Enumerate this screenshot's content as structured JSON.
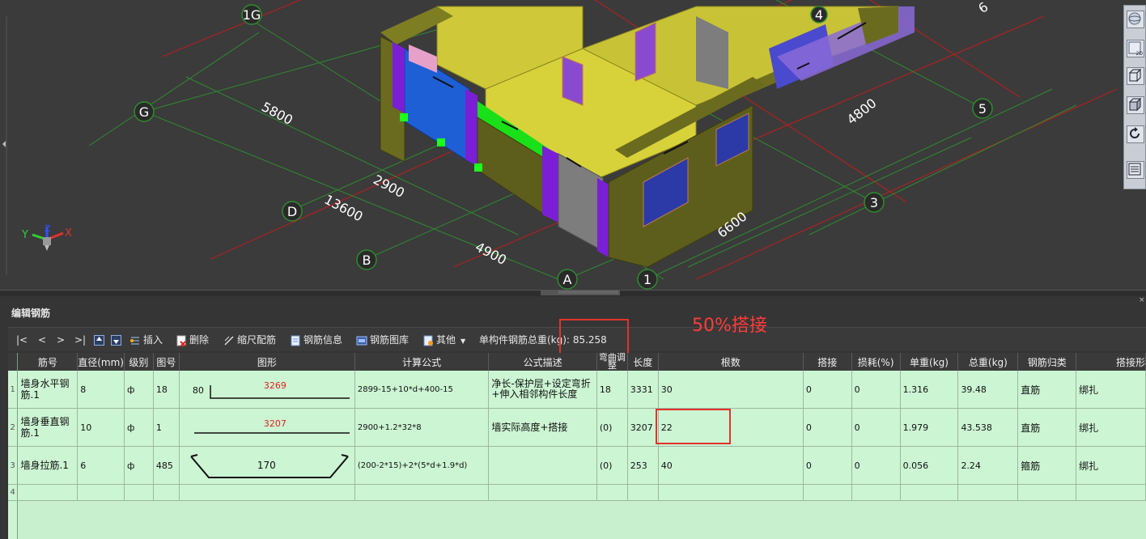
{
  "viewport": {
    "axis_labels": [
      "1G",
      "G",
      "D",
      "B",
      "A",
      "1",
      "3",
      "5",
      "4",
      "6"
    ],
    "dimensions": [
      "5800",
      "2900",
      "13600",
      "4900",
      "4800",
      "6600"
    ],
    "gizmo": {
      "x": "X",
      "y": "Y",
      "z": "Z"
    }
  },
  "viewbar": {
    "buttons": [
      "globe-icon",
      "view-2d-icon",
      "cube-3d-icon",
      "cube-solid-icon",
      "rotate-icon",
      "layer-list-icon"
    ],
    "label_2d": "2D"
  },
  "panel": {
    "title": "编辑钢筋",
    "nav": [
      "|<",
      "<",
      ">",
      ">|"
    ],
    "buttons": {
      "insert": "插入",
      "delete": "删除",
      "scale": "缩尺配筋",
      "info": "钢筋信息",
      "library": "钢筋图库",
      "other": "其他"
    },
    "weight_label": "单构件钢筋总重(kg):",
    "weight_value": "85.258"
  },
  "annotation": "50%搭接",
  "table": {
    "headers": [
      "筋号",
      "直径(mm)",
      "级别",
      "图号",
      "图形",
      "计算公式",
      "公式描述",
      "弯曲调整",
      "长度",
      "根数",
      "搭接",
      "损耗(%)",
      "单重(kg)",
      "总重(kg)",
      "钢筋归类",
      "搭接形"
    ],
    "rows": [
      {
        "num": "1",
        "name": "墙身水平钢筋.1",
        "dia": "8",
        "grade": "ф",
        "fig": "18",
        "shape_left": "80",
        "shape_value": "3269",
        "formula": "2899-15+10*d+400-15",
        "desc": "净长-保护层+设定弯折+伸入相邻构件长度",
        "bend": "18",
        "length": "3331",
        "count": "30",
        "lap": "0",
        "loss": "0",
        "unit": "1.316",
        "total": "39.48",
        "cat": "直筋",
        "laptype": "绑扎"
      },
      {
        "num": "2",
        "name": "墙身垂直钢筋.1",
        "dia": "10",
        "grade": "ф",
        "fig": "1",
        "shape_left": "",
        "shape_value": "3207",
        "formula": "2900+1.2*32*8",
        "desc": "墙实际高度+搭接",
        "bend": "(0)",
        "length": "3207",
        "count": "22",
        "lap": "0",
        "loss": "0",
        "unit": "1.979",
        "total": "43.538",
        "cat": "直筋",
        "laptype": "绑扎"
      },
      {
        "num": "3",
        "name": "墙身拉筋.1",
        "dia": "6",
        "grade": "ф",
        "fig": "485",
        "shape_left": "",
        "shape_value": "170",
        "formula": "(200-2*15)+2*(5*d+1.9*d)",
        "desc": "",
        "bend": "(0)",
        "length": "253",
        "count": "40",
        "lap": "0",
        "loss": "0",
        "unit": "0.056",
        "total": "2.24",
        "cat": "箍筋",
        "laptype": "绑扎"
      }
    ],
    "empty_row_num": "4"
  },
  "colors": {
    "grid_bg": "#ccf5d3",
    "annotation_red": "#ff3b3b",
    "wall_yellow": "#d8d23a",
    "wall_olive": "#6b6b1f",
    "column_purple": "#7a1fd6",
    "wall_blue": "#1f5fd6",
    "wall_green": "#19e019"
  }
}
